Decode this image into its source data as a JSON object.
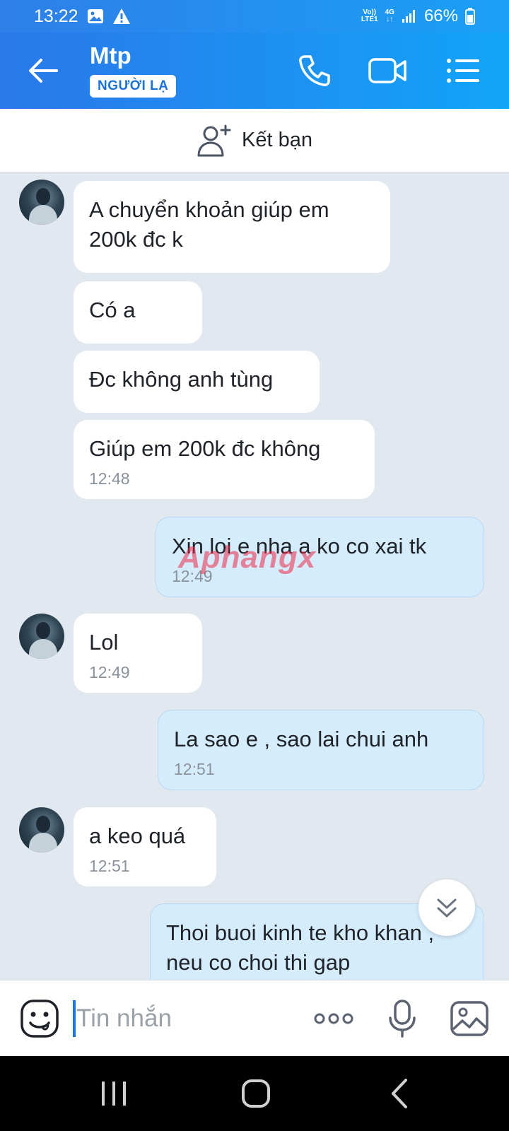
{
  "status": {
    "time": "13:22",
    "volte_top": "Vo))",
    "volte_bottom": "LTE1",
    "network": "4G",
    "battery": "66%"
  },
  "header": {
    "title": "Mtp",
    "badge": "NGƯỜI LẠ"
  },
  "add_friend": {
    "label": "Kết bạn"
  },
  "messages": [
    {
      "dir": "in",
      "text": "A chuyển khoản giúp em 200k đc k",
      "time": ""
    },
    {
      "dir": "in",
      "text": "Có a",
      "time": ""
    },
    {
      "dir": "in",
      "text": "Đc không anh tùng",
      "time": ""
    },
    {
      "dir": "in",
      "text": "Giúp em 200k đc không",
      "time": "12:48"
    },
    {
      "dir": "out",
      "text": "Xin loi e nha a ko co xai tk",
      "time": "12:49"
    },
    {
      "dir": "in",
      "text": "Lol",
      "time": "12:49"
    },
    {
      "dir": "out",
      "text": "La sao e , sao lai chui anh",
      "time": "12:51"
    },
    {
      "dir": "in",
      "text": "a keo quá",
      "time": "12:51"
    },
    {
      "dir": "out",
      "text": "Thoi buoi kinh te kho khan , neu co choi thi gap",
      "time": ""
    }
  ],
  "watermark": "Aphangx",
  "composer": {
    "placeholder": "Tin nhắn"
  },
  "icons": {
    "back": "arrow-left-icon",
    "call": "phone-icon",
    "video": "video-camera-icon",
    "menu": "list-menu-icon",
    "add_friend": "add-user-icon",
    "emoji": "emoji-icon",
    "more": "more-dots-icon",
    "mic": "microphone-icon",
    "image": "image-icon",
    "scroll": "chevron-double-down-icon"
  },
  "colors": {
    "header_start": "#2a78ea",
    "header_end": "#12a4f7",
    "outgoing_bubble": "#d5ecfc",
    "chat_bg": "#e2e8f0"
  }
}
